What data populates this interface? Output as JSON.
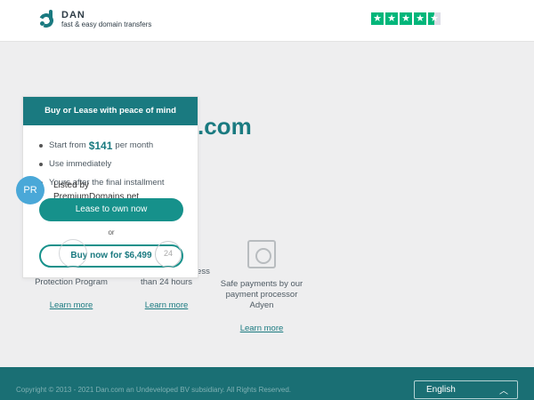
{
  "brand": {
    "name": "DAN",
    "tagline": "fast & easy domain transfers"
  },
  "trustpilot": {
    "rating_stars": 4.5,
    "color": "#00b67a"
  },
  "domain": {
    "visible_suffix": ".com"
  },
  "card": {
    "header": "Buy or Lease with peace of mind",
    "items": [
      {
        "prefix": "Start from",
        "price": "$141",
        "suffix": "per month"
      },
      {
        "text": "Use immediately"
      },
      {
        "text": "Yours after the final installment"
      }
    ],
    "broker_line1": "Listed by",
    "broker_line2": "PremiumDomains.net",
    "avatar_initials": "PR",
    "lease_label": "Lease to own now",
    "or_label": "or",
    "buy_label": "Buy now for $6,499"
  },
  "features": [
    {
      "text": "Covered by our Buyer Protection Program",
      "link": "Learn more",
      "icon": "globe-icon"
    },
    {
      "text": "Use this domain in less than 24 hours",
      "link": "Learn more",
      "icon": "clock-24-icon",
      "clock_label": "24"
    },
    {
      "text": "Safe payments by our payment processor Adyen",
      "link": "Learn more",
      "icon": "safe-icon"
    }
  ],
  "footer": {
    "copyright": "Copyright © 2013 - 2021 Dan.com an Undeveloped BV subsidiary. All Rights Reserved.",
    "language": "English"
  },
  "colors": {
    "accent": "#1a7a80",
    "button": "#16918b",
    "footer": "#1a6f74"
  }
}
